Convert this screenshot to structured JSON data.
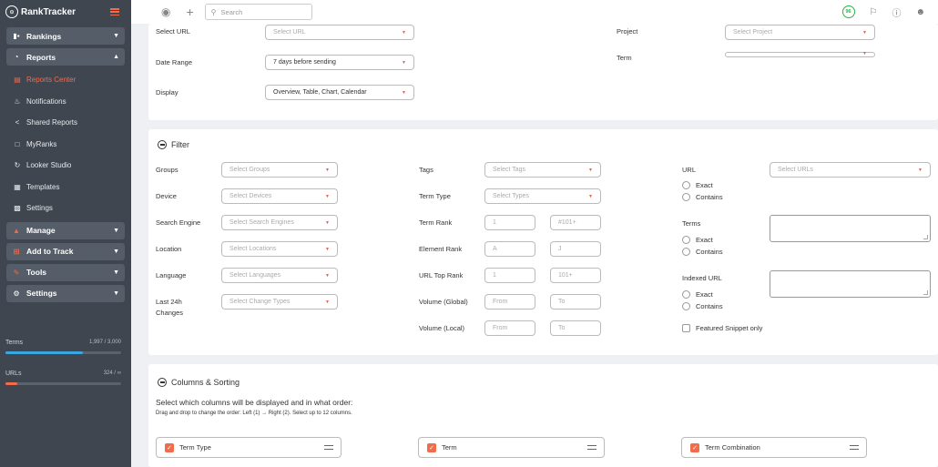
{
  "brand": {
    "name": "RankTracker",
    "mark": "⊙"
  },
  "sidebar": {
    "groups": {
      "rankings": "Rankings",
      "reports": "Reports",
      "manage": "Manage",
      "add_to_track": "Add to Track",
      "tools": "Tools",
      "settings": "Settings"
    },
    "report_items": {
      "reports_center": "Reports Center",
      "notifications": "Notifications",
      "shared_reports": "Shared Reports",
      "myranks": "MyRanks",
      "looker_studio": "Looker Studio",
      "templates": "Templates",
      "settings": "Settings"
    },
    "usage": {
      "terms": {
        "label": "Terms",
        "value": "1,997 / 3,000",
        "fraction": 0.666
      },
      "urls": {
        "label": "URLs",
        "value": "324 / ∞",
        "fraction": 0.1
      }
    }
  },
  "topbar": {
    "search_placeholder": "Search",
    "score": "96"
  },
  "report": {
    "select_url": {
      "label": "Select URL",
      "placeholder": "Select URL"
    },
    "project": {
      "label": "Project",
      "placeholder": "Select Project"
    },
    "date_range": {
      "label": "Date Range",
      "value": "7 days before sending"
    },
    "term": {
      "label": "Term"
    },
    "display": {
      "label": "Display",
      "value": "Overview, Table, Chart, Calendar"
    }
  },
  "filter": {
    "title": "Filter",
    "groups": {
      "label": "Groups",
      "placeholder": "Select Groups"
    },
    "device": {
      "label": "Device",
      "placeholder": "Select Devices"
    },
    "search_engine": {
      "label": "Search Engine",
      "placeholder": "Select Search Engines"
    },
    "location": {
      "label": "Location",
      "placeholder": "Select Locations"
    },
    "language": {
      "label": "Language",
      "placeholder": "Select Languages"
    },
    "changes": {
      "label1": "Last 24h",
      "label2": "Changes",
      "placeholder": "Select Change Types"
    },
    "tags": {
      "label": "Tags",
      "placeholder": "Select Tags"
    },
    "term_type": {
      "label": "Term Type",
      "placeholder": "Select Types"
    },
    "term_rank": {
      "label": "Term Rank",
      "from": "1",
      "to": "#101+"
    },
    "element_rank": {
      "label": "Element Rank",
      "from": "A",
      "to": "J"
    },
    "url_top_rank": {
      "label": "URL Top Rank",
      "from": "1",
      "to": "101+"
    },
    "volume_global": {
      "label": "Volume (Global)",
      "from": "From",
      "to": "To"
    },
    "volume_local": {
      "label": "Volume (Local)",
      "from": "From",
      "to": "To"
    },
    "url": {
      "label": "URL",
      "placeholder": "Select URLs",
      "exact": "Exact",
      "contains": "Contains"
    },
    "terms": {
      "label": "Terms",
      "exact": "Exact",
      "contains": "Contains"
    },
    "indexed_url": {
      "label": "Indexed URL",
      "exact": "Exact",
      "contains": "Contains"
    },
    "featured_snippet": "Featured Snippet only"
  },
  "columns": {
    "title": "Columns & Sorting",
    "subtitle": "Select which columns will be displayed and in what order:",
    "hint": "Drag and drop to change the order: Left (1) → Right (2). Select up to 12 columns.",
    "items": [
      "Term Type",
      "Term",
      "Term Combination"
    ]
  },
  "colors": {
    "accent": "#f26b4b",
    "sidebar_bg": "#3f4650",
    "terms_bar": "#3aa6df",
    "urls_bar": "#f26b4b",
    "score": "#2eb24a"
  }
}
